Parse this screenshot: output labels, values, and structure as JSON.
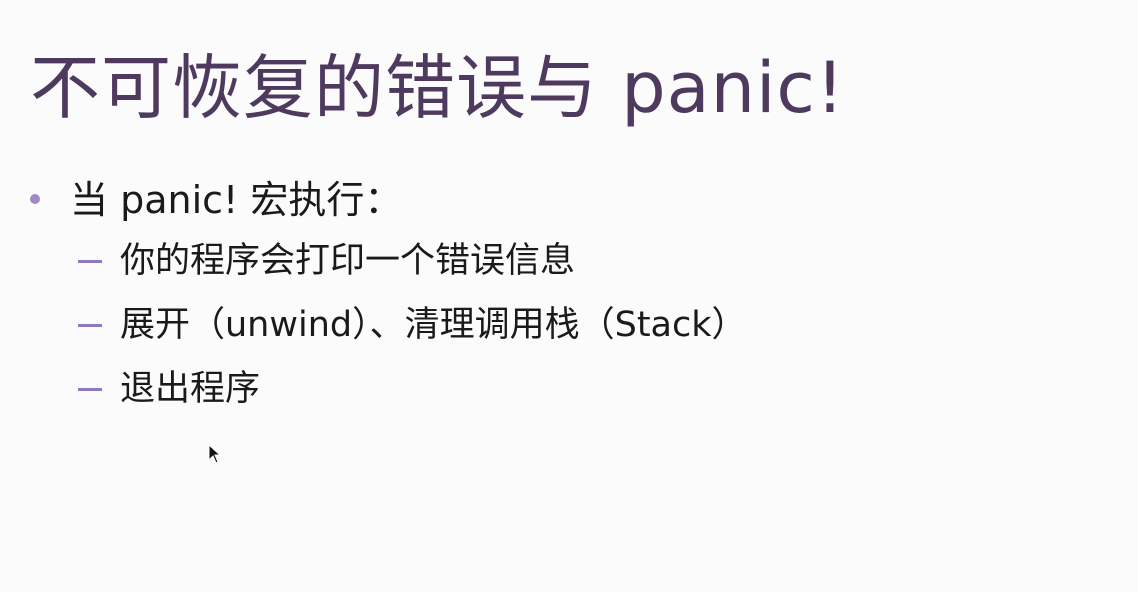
{
  "slide": {
    "title": "不可恢复的错误与 panic!",
    "bullet": {
      "text": "当 panic! 宏执行："
    },
    "sub_items": [
      {
        "text": "你的程序会打印一个错误信息"
      },
      {
        "text": "展开（unwind）、清理调用栈（Stack）"
      },
      {
        "text": "退出程序"
      }
    ]
  },
  "colors": {
    "title": "#4f3a5f",
    "bullet_dot": "#a08ac4",
    "dash": "#8f7ab8",
    "body_text": "#1a1a1a",
    "background": "#fbfbfb"
  },
  "icons": {
    "cursor": "mouse-pointer-icon"
  }
}
